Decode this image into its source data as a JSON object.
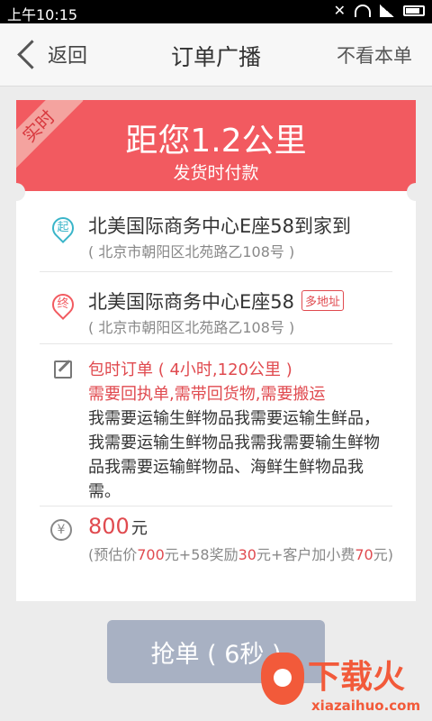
{
  "status_bar": {
    "time": "上午10:15",
    "icons": [
      "mute-icon",
      "wifi-icon",
      "signal-icon",
      "battery-icon"
    ]
  },
  "header": {
    "back_label": "返回",
    "title": "订单广播",
    "skip_label": "不看本单"
  },
  "order": {
    "badge": "实时",
    "distance": "距您1.2公里",
    "payment": "发货时付款",
    "start": {
      "marker": "起",
      "name": "北美国际商务中心E座58到家到",
      "address": "( 北京市朝阳区北苑路乙108号 )"
    },
    "end": {
      "marker": "终",
      "name": "北美国际商务中心E座58",
      "tag": "多地址",
      "address": "( 北京市朝阳区北苑路乙108号 )"
    },
    "package": "包时订单 ( 4小时,120公里 )",
    "requirements": "需要回执单,需带回货物,需要搬运",
    "note": "我需要运输生鲜物品我需要运输生鲜品，我需要运输生鲜物品我需我需要输生鲜物品我需要运输鲜物品、海鲜生鲜物品我需。",
    "price": "800",
    "price_unit": "元",
    "breakdown": {
      "p1": "(预估价",
      "estimate": "700",
      "p2": "元+58奖励",
      "reward": "30",
      "p3": "元+客户加小费",
      "tip": "70",
      "p4": "元)"
    }
  },
  "action": {
    "grab_label": "抢单 ( 6秒 )"
  },
  "watermark": {
    "text": "下载火",
    "sub": "xiazaihuo.com"
  },
  "colors": {
    "accent_red": "#f25a60",
    "button_disabled": "#a8b1c3",
    "start_pin": "#3ab5c9"
  }
}
